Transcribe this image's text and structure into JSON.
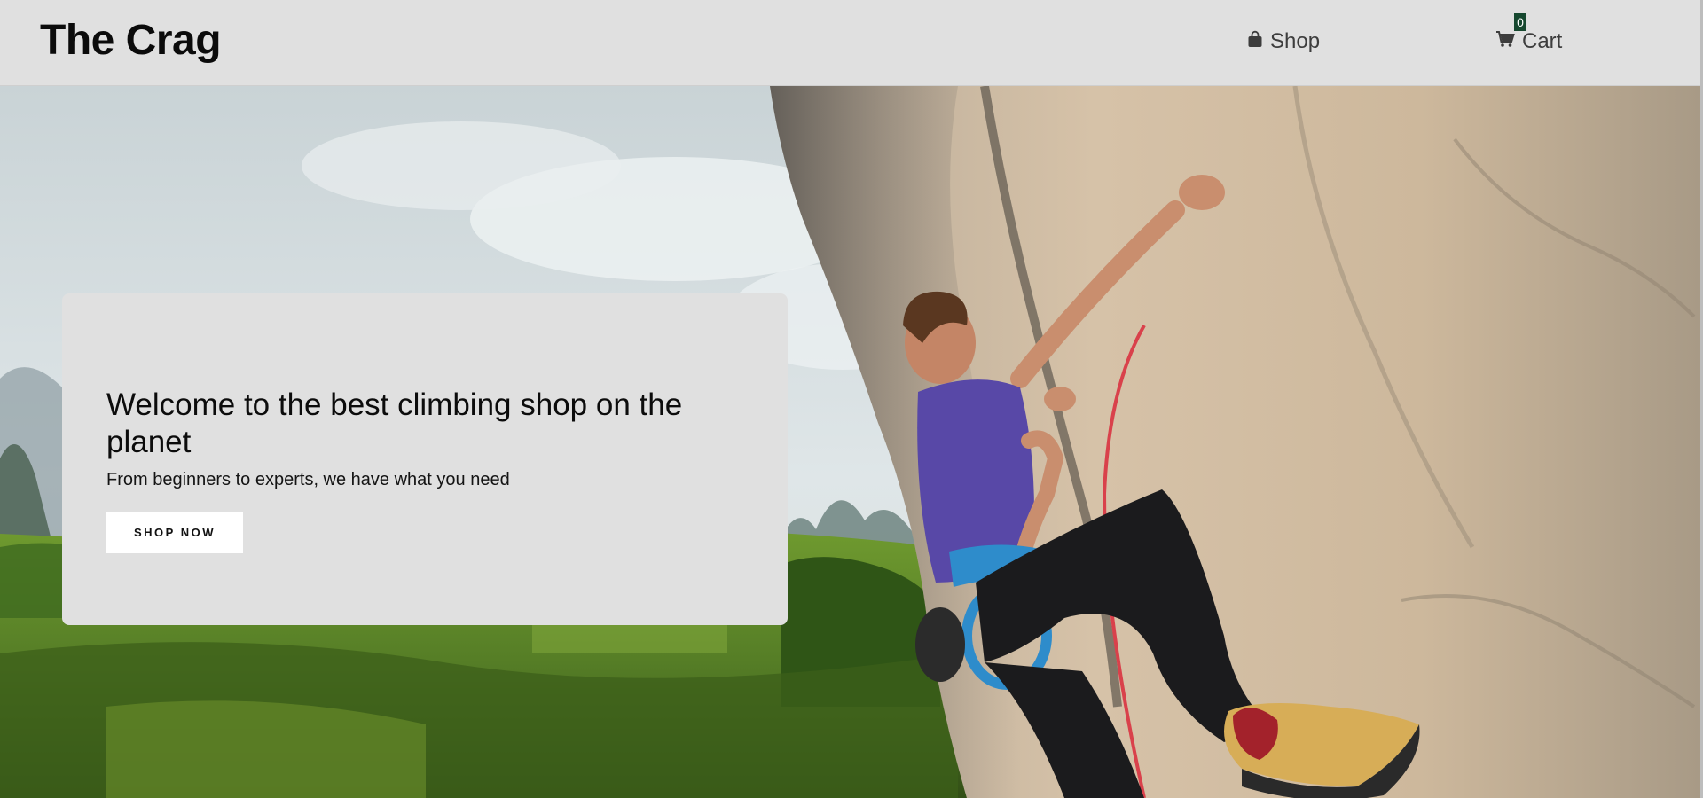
{
  "header": {
    "logo": "The Crag",
    "nav": {
      "shop_label": "Shop",
      "shop_icon": "shopping-bag-icon",
      "cart_label": "Cart",
      "cart_icon": "shopping-cart-icon",
      "cart_count": "0"
    }
  },
  "hero": {
    "image": "climber on limestone cliff above green valley",
    "title": "Welcome to the best climbing shop on the planet",
    "subtitle": "From beginners to experts, we have what you need",
    "cta_label": "SHOP NOW"
  },
  "colors": {
    "header_bg": "#e0e0e0",
    "card_bg": "#e0e0e0",
    "badge_bg": "#16482f",
    "button_bg": "#ffffff",
    "text": "#0c0c0c"
  }
}
